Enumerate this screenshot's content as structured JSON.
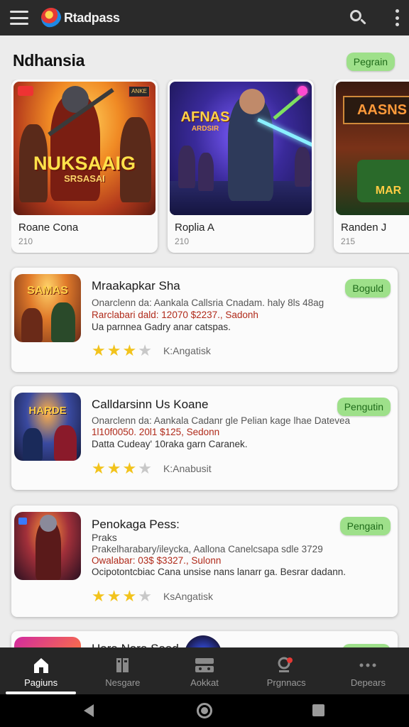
{
  "app": {
    "title": "Rtadpass"
  },
  "section": {
    "title": "Ndhansia",
    "button": "Pegrain"
  },
  "featured": [
    {
      "name": "Roane Cona",
      "number": "210",
      "art_text": "NUKSAAIG",
      "art_subtext": "SRSASAI",
      "badge": "ANKE"
    },
    {
      "name": "Roplia A",
      "number": "210",
      "art_text": "AFNAS",
      "art_subtext": "ARDSIR"
    },
    {
      "name": "Randen J",
      "number": "215",
      "art_text": "AASNS",
      "art_subtext": "MAR"
    }
  ],
  "list": [
    {
      "title": "Mraakapkar Sha",
      "desc": "Onarclenn da: Aankala Callsria Cnadam. haly 8ls 48ag",
      "price": "Rarclabari dald: 12070 $2237., Sadonh",
      "note": "Ua parnnea Gadry anar catspas.",
      "rating": 3,
      "rating_label": "K:Angatisk",
      "button": "Boguld",
      "thumb_text": "SAMAS"
    },
    {
      "title": "Calldarsinn Us Koane",
      "desc": "Onarclenn da: Aankala Cadanr gle Pelian kage lhae Datevea",
      "price": "1l10f0050. 20l1 $125, Sedonn",
      "note": "Datta Cudeay' 10raka garn Caranek.",
      "rating": 3,
      "rating_label": "K:Anabusit",
      "button": "Pengutin",
      "thumb_text": "HARDE"
    },
    {
      "title": "Penokaga Pess:",
      "sub": "Praks",
      "desc": "Prakelharabary/ileycka, Aallona Canelcsapa sdle 3729",
      "price": "Owalabar: 03$ $3327., Sulonn",
      "note": "Ocipotontcbiac Cana unsise nans lanarr ga. Besrar dadann.",
      "rating": 3,
      "rating_label": "KsAngatisk",
      "button": "Pengain"
    },
    {
      "title": "Hara Nara Saad",
      "button": "Pegrain"
    }
  ],
  "nav": [
    {
      "label": "Pagiuns",
      "icon": "home-icon"
    },
    {
      "label": "Nesgare",
      "icon": "library-icon"
    },
    {
      "label": "Aokkat",
      "icon": "controller-icon"
    },
    {
      "label": "Prgnnacs",
      "icon": "profile-icon"
    },
    {
      "label": "Depears",
      "icon": "more-icon"
    }
  ],
  "colors": {
    "accent_pill": "#9ee08a",
    "pill_text": "#1f6b1a",
    "star": "#f2c31c",
    "price": "#b02a1a",
    "bar": "#2a2a2a"
  }
}
